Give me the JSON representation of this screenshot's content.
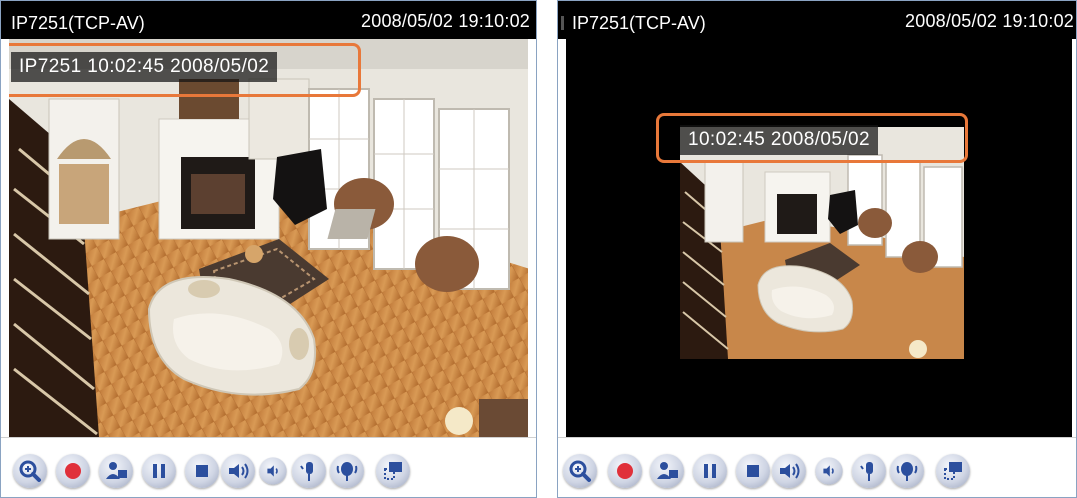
{
  "left_panel": {
    "camera_name": "IP7251(TCP-AV)",
    "timestamp": "2008/05/02 19:10:02",
    "overlay_text": "IP7251 10:02:45 2008/05/02"
  },
  "right_panel": {
    "camera_name": "IP7251(TCP-AV)",
    "timestamp": "2008/05/02 19:10:02",
    "overlay_text": "10:02:45 2008/05/02"
  },
  "controls": [
    {
      "icon": "zoom-in-icon"
    },
    {
      "icon": "record-icon"
    },
    {
      "icon": "snapshot-icon"
    },
    {
      "icon": "pause-icon"
    },
    {
      "icon": "stop-icon"
    },
    {
      "icon": "talk-icon"
    },
    {
      "icon": "volume-icon"
    },
    {
      "icon": "mic-icon"
    },
    {
      "icon": "mic-mute-icon"
    },
    {
      "icon": "fullscreen-icon"
    }
  ],
  "colors": {
    "title_bar": "#000000",
    "highlight": "#e8783a",
    "panel_border": "#8aa3c2",
    "record": "#e0303a",
    "icon_blue": "#2c4f9e"
  }
}
